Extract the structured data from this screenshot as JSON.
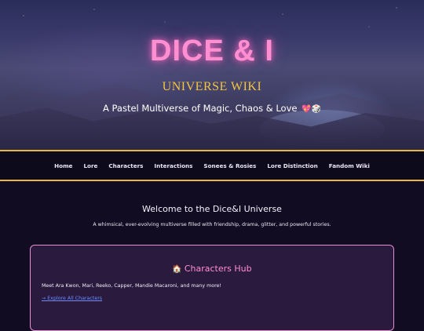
{
  "hero": {
    "title": "DICE & I",
    "subtitle": "UNIVERSE WIKI",
    "tagline": "A Pastel Multiverse of Magic, Chaos & Love",
    "tagline_emoji": "💖🎲"
  },
  "nav": {
    "items": [
      {
        "label": "Home"
      },
      {
        "label": "Lore"
      },
      {
        "label": "Characters"
      },
      {
        "label": "Interactions"
      },
      {
        "label": "Sonees & Rosies"
      },
      {
        "label": "Lore Distinction"
      },
      {
        "label": "Fandom Wiki"
      }
    ]
  },
  "welcome": {
    "title": "Welcome to the Dice&I Universe",
    "text": "A whimsical, ever-evolving multiverse filled with friendship, drama, glitter, and powerful stories."
  },
  "characters_hub": {
    "icon": "🏠",
    "title": "Characters Hub",
    "text": "Meet Ara Kwon, Mari, Reeko, Capper, Mandie Macaroni, and many more!",
    "link": "→ Explore All Characters"
  },
  "colors": {
    "accent_gold": "#e8b93a",
    "title_pink": "#ff8fd0",
    "link_blue": "#6f8cff",
    "background": "#120c22"
  }
}
